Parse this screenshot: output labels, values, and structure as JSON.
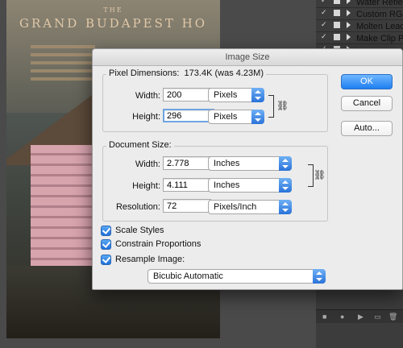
{
  "poster": {
    "the": "THE",
    "title": "GRAND BUDAPEST HO"
  },
  "actions_panel": {
    "items": [
      {
        "label": "Water Reflec"
      },
      {
        "label": "Custom RGB"
      },
      {
        "label": "Molten Lead"
      },
      {
        "label": "Make Clip Pa"
      },
      {
        "label": ""
      }
    ]
  },
  "dialog": {
    "title": "Image Size",
    "pixel_dimensions": {
      "label": "Pixel Dimensions:",
      "size": "173.4K (was 4.23M)",
      "width_label": "Width:",
      "width_value": "200",
      "width_unit": "Pixels",
      "height_label": "Height:",
      "height_value": "296",
      "height_unit": "Pixels"
    },
    "document_size": {
      "label": "Document Size:",
      "width_label": "Width:",
      "width_value": "2.778",
      "width_unit": "Inches",
      "height_label": "Height:",
      "height_value": "4.111",
      "height_unit": "Inches",
      "resolution_label": "Resolution:",
      "resolution_value": "72",
      "resolution_unit": "Pixels/Inch"
    },
    "options": {
      "scale_styles": "Scale Styles",
      "constrain_proportions": "Constrain Proportions",
      "resample_image": "Resample Image:",
      "resample_method": "Bicubic Automatic"
    },
    "buttons": {
      "ok": "OK",
      "cancel": "Cancel",
      "auto": "Auto..."
    }
  }
}
